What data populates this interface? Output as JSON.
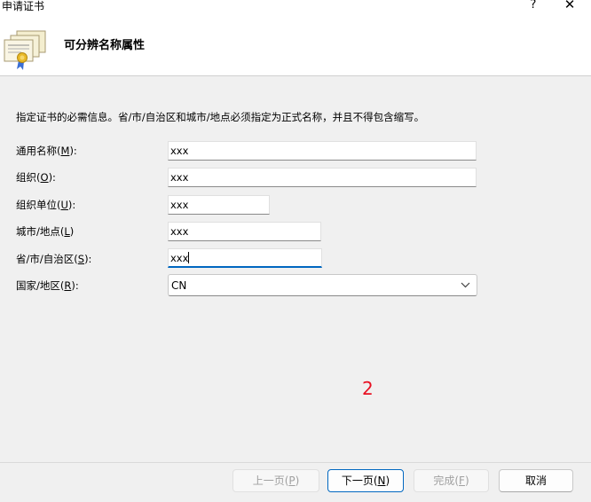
{
  "window": {
    "title": "申请证书",
    "help_label": "?",
    "close_label": "✕"
  },
  "header": {
    "icon": "certificate-icon",
    "title": "可分辨名称属性"
  },
  "description": "指定证书的必需信息。省/市/自治区和城市/地点必须指定为正式名称，并且不得包含缩写。",
  "fields": {
    "common_name": {
      "label": "通用名称(",
      "accel": "M",
      "suffix": "):",
      "value": "xxx"
    },
    "organization": {
      "label": "组织(",
      "accel": "O",
      "suffix": "):",
      "value": "xxx"
    },
    "org_unit": {
      "label": "组织单位(",
      "accel": "U",
      "suffix": "):",
      "value": "xxx"
    },
    "city": {
      "label": "城市/地点(",
      "accel": "L",
      "suffix": ")",
      "value": "xxx"
    },
    "state": {
      "label": "省/市/自治区(",
      "accel": "S",
      "suffix": "):",
      "value": "xxx"
    },
    "country": {
      "label": "国家/地区(",
      "accel": "R",
      "suffix": "):",
      "value": "CN"
    }
  },
  "page_number": "2",
  "footer": {
    "back_label": "上一页(",
    "back_accel": "P",
    "back_suffix": ")",
    "next_label": "下一页(",
    "next_accel": "N",
    "next_suffix": ")",
    "finish_label": "完成(",
    "finish_accel": "F",
    "finish_suffix": ")",
    "cancel_label": "取消"
  },
  "colors": {
    "accent": "#0067c0",
    "page_number": "#e81123"
  }
}
